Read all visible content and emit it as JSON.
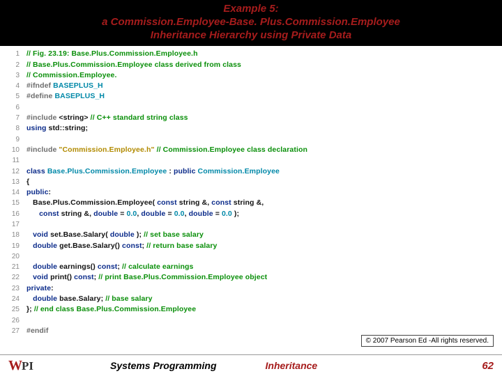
{
  "title": {
    "line1": "Example 5:",
    "line2": "a Commission.Employee-Base. Plus.Commission.Employee",
    "line3": "Inheritance Hierarchy using Private Data"
  },
  "code": [
    {
      "n": "1",
      "tokens": [
        {
          "c": "c-comment",
          "t": "// Fig. 23.19: Base.Plus.Commission.Employee.h"
        }
      ]
    },
    {
      "n": "2",
      "tokens": [
        {
          "c": "c-comment",
          "t": "// Base.Plus.Commission.Employee class derived from class"
        }
      ]
    },
    {
      "n": "3",
      "tokens": [
        {
          "c": "c-comment",
          "t": "// Commission.Employee."
        }
      ]
    },
    {
      "n": "4",
      "tokens": [
        {
          "c": "c-pp",
          "t": "#ifndef "
        },
        {
          "c": "c-macro",
          "t": "BASEPLUS_H"
        }
      ]
    },
    {
      "n": "5",
      "tokens": [
        {
          "c": "c-pp",
          "t": "#define "
        },
        {
          "c": "c-macro",
          "t": "BASEPLUS_H"
        }
      ]
    },
    {
      "n": "6",
      "tokens": []
    },
    {
      "n": "7",
      "tokens": [
        {
          "c": "c-pp",
          "t": "#include "
        },
        {
          "c": "c-id",
          "t": "<string> "
        },
        {
          "c": "c-comment",
          "t": "// C++ standard string class"
        }
      ]
    },
    {
      "n": "8",
      "tokens": [
        {
          "c": "c-kw",
          "t": "using"
        },
        {
          "c": "c-id",
          "t": " std::string;"
        }
      ]
    },
    {
      "n": "9",
      "tokens": []
    },
    {
      "n": "10",
      "tokens": [
        {
          "c": "c-pp",
          "t": "#include "
        },
        {
          "c": "c-str",
          "t": "\"Commission.Employee.h\""
        },
        {
          "c": "c-id",
          "t": " "
        },
        {
          "c": "c-comment",
          "t": "// Commission.Employee class declaration"
        }
      ]
    },
    {
      "n": "11",
      "tokens": []
    },
    {
      "n": "12",
      "tokens": [
        {
          "c": "c-kw",
          "t": "class"
        },
        {
          "c": "c-id",
          "t": " "
        },
        {
          "c": "c-type",
          "t": "Base.Plus.Commission.Employee"
        },
        {
          "c": "c-id",
          "t": " : "
        },
        {
          "c": "c-kw",
          "t": "public"
        },
        {
          "c": "c-id",
          "t": " "
        },
        {
          "c": "c-type",
          "t": "Commission.Employee"
        }
      ]
    },
    {
      "n": "13",
      "tokens": [
        {
          "c": "c-id",
          "t": "{"
        }
      ]
    },
    {
      "n": "14",
      "tokens": [
        {
          "c": "c-kw",
          "t": "public"
        },
        {
          "c": "c-id",
          "t": ":"
        }
      ]
    },
    {
      "n": "15",
      "tokens": [
        {
          "c": "c-id",
          "t": "   Base.Plus.Commission.Employee( "
        },
        {
          "c": "c-kw",
          "t": "const"
        },
        {
          "c": "c-id",
          "t": " string &, "
        },
        {
          "c": "c-kw",
          "t": "const"
        },
        {
          "c": "c-id",
          "t": " string &,"
        }
      ]
    },
    {
      "n": "16",
      "tokens": [
        {
          "c": "c-id",
          "t": "      "
        },
        {
          "c": "c-kw",
          "t": "const"
        },
        {
          "c": "c-id",
          "t": " string &, "
        },
        {
          "c": "c-kw",
          "t": "double"
        },
        {
          "c": "c-id",
          "t": " = "
        },
        {
          "c": "c-type",
          "t": "0.0"
        },
        {
          "c": "c-id",
          "t": ", "
        },
        {
          "c": "c-kw",
          "t": "double"
        },
        {
          "c": "c-id",
          "t": " = "
        },
        {
          "c": "c-type",
          "t": "0.0"
        },
        {
          "c": "c-id",
          "t": ", "
        },
        {
          "c": "c-kw",
          "t": "double"
        },
        {
          "c": "c-id",
          "t": " = "
        },
        {
          "c": "c-type",
          "t": "0.0"
        },
        {
          "c": "c-id",
          "t": " );"
        }
      ]
    },
    {
      "n": "17",
      "tokens": []
    },
    {
      "n": "18",
      "tokens": [
        {
          "c": "c-id",
          "t": "   "
        },
        {
          "c": "c-kw",
          "t": "void"
        },
        {
          "c": "c-id",
          "t": " set.Base.Salary( "
        },
        {
          "c": "c-kw",
          "t": "double"
        },
        {
          "c": "c-id",
          "t": " ); "
        },
        {
          "c": "c-comment",
          "t": "// set base salary"
        }
      ]
    },
    {
      "n": "19",
      "tokens": [
        {
          "c": "c-id",
          "t": "   "
        },
        {
          "c": "c-kw",
          "t": "double"
        },
        {
          "c": "c-id",
          "t": " get.Base.Salary() "
        },
        {
          "c": "c-kw",
          "t": "const"
        },
        {
          "c": "c-id",
          "t": "; "
        },
        {
          "c": "c-comment",
          "t": "// return base salary"
        }
      ]
    },
    {
      "n": "20",
      "tokens": []
    },
    {
      "n": "21",
      "tokens": [
        {
          "c": "c-id",
          "t": "   "
        },
        {
          "c": "c-kw",
          "t": "double"
        },
        {
          "c": "c-id",
          "t": " earnings() "
        },
        {
          "c": "c-kw",
          "t": "const"
        },
        {
          "c": "c-id",
          "t": "; "
        },
        {
          "c": "c-comment",
          "t": "// calculate earnings"
        }
      ]
    },
    {
      "n": "22",
      "tokens": [
        {
          "c": "c-id",
          "t": "   "
        },
        {
          "c": "c-kw",
          "t": "void"
        },
        {
          "c": "c-id",
          "t": " print() "
        },
        {
          "c": "c-kw",
          "t": "const"
        },
        {
          "c": "c-id",
          "t": "; "
        },
        {
          "c": "c-comment",
          "t": "// print Base.Plus.Commission.Employee object"
        }
      ]
    },
    {
      "n": "23",
      "tokens": [
        {
          "c": "c-kw",
          "t": "private"
        },
        {
          "c": "c-id",
          "t": ":"
        }
      ]
    },
    {
      "n": "24",
      "tokens": [
        {
          "c": "c-id",
          "t": "   "
        },
        {
          "c": "c-kw",
          "t": "double"
        },
        {
          "c": "c-id",
          "t": " base.Salary; "
        },
        {
          "c": "c-comment",
          "t": "// base salary"
        }
      ]
    },
    {
      "n": "25",
      "tokens": [
        {
          "c": "c-id",
          "t": "}; "
        },
        {
          "c": "c-comment",
          "t": "// end class Base.Plus.Commission.Employee"
        }
      ]
    },
    {
      "n": "26",
      "tokens": []
    },
    {
      "n": "27",
      "tokens": [
        {
          "c": "c-pp",
          "t": "#endif"
        }
      ]
    }
  ],
  "copyright": "© 2007 Pearson Ed -All rights reserved.",
  "footer": {
    "course": "Systems Programming",
    "topic": "Inheritance",
    "page": "62"
  },
  "logo": {
    "w": "W",
    "pi": "PI"
  }
}
